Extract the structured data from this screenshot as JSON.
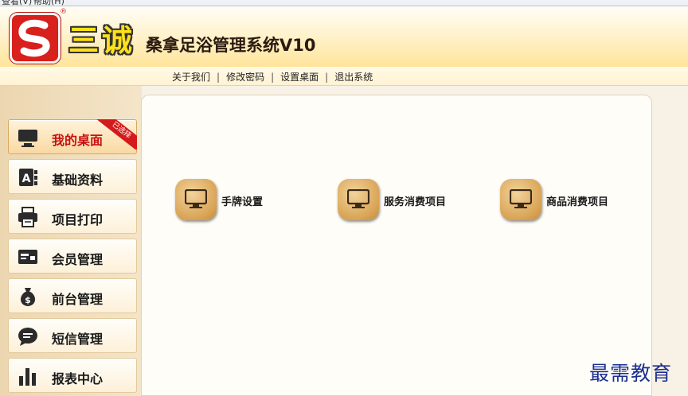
{
  "window": {
    "menu_items": [
      "查看(V)",
      "帮助(H)"
    ]
  },
  "header": {
    "logo_letter": "S",
    "brand": "三诚",
    "system_name": "桑拿足浴管理系统V10",
    "reg_mark": "®"
  },
  "nav": {
    "links": [
      "关于我们",
      "修改密码",
      "设置桌面",
      "退出系统"
    ],
    "separator": "|"
  },
  "sidebar": {
    "items": [
      {
        "label": "我的桌面",
        "icon": "monitor-icon",
        "active": true,
        "badge": "已选择"
      },
      {
        "label": "基础资料",
        "icon": "info-book-icon"
      },
      {
        "label": "项目打印",
        "icon": "printer-icon"
      },
      {
        "label": "会员管理",
        "icon": "member-card-icon"
      },
      {
        "label": "前台管理",
        "icon": "money-bag-icon"
      },
      {
        "label": "短信管理",
        "icon": "message-bubble-icon"
      },
      {
        "label": "报表中心",
        "icon": "bar-chart-icon"
      }
    ]
  },
  "desktop": {
    "shortcuts": [
      {
        "label": "手牌设置",
        "icon": "monitor-icon"
      },
      {
        "label": "服务消费项目",
        "icon": "monitor-icon"
      },
      {
        "label": "商品消费项目",
        "icon": "monitor-icon"
      }
    ]
  },
  "watermark": "最需教育",
  "colors": {
    "accent_red": "#d8201c",
    "brand_yellow": "#ffe01a",
    "tile_tan": "#d9a455",
    "watermark_blue": "#1c2f8f"
  }
}
